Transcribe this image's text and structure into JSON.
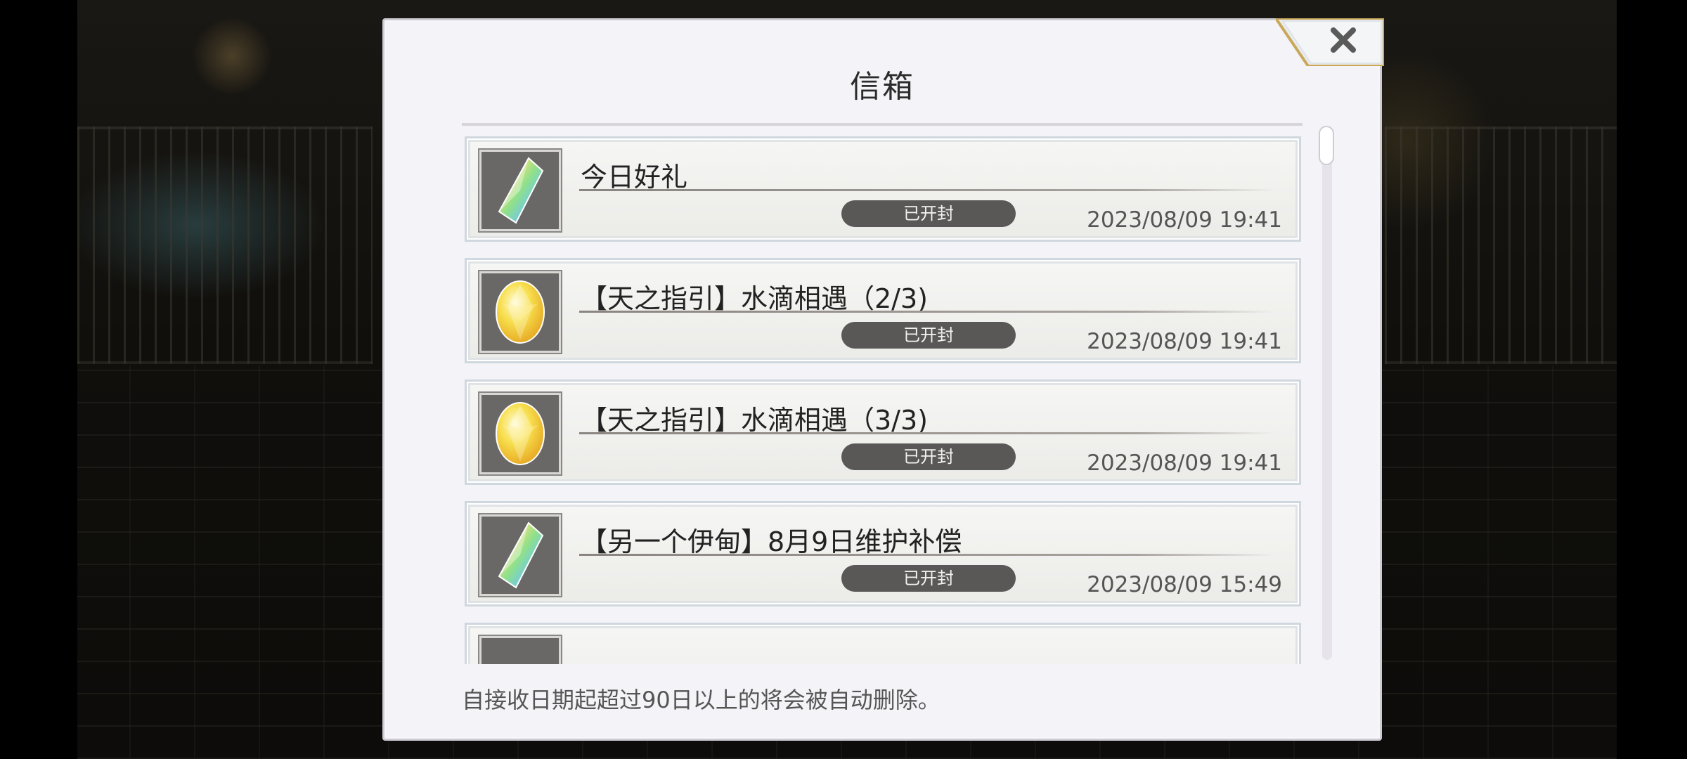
{
  "dialog": {
    "title": "信箱",
    "close_icon": "close-x-icon",
    "footer_note": "自接收日期起超过90日以上的将会被自动删除。"
  },
  "mail_items": [
    {
      "title": "今日好礼",
      "status": "已开封",
      "date": "2023/08/09 19:41",
      "icon": "rainbow-crystal-icon"
    },
    {
      "title": "【天之指引】水滴相遇（2/3)",
      "status": "已开封",
      "date": "2023/08/09 19:41",
      "icon": "golden-gem-icon"
    },
    {
      "title": "【天之指引】水滴相遇（3/3)",
      "status": "已开封",
      "date": "2023/08/09 19:41",
      "icon": "golden-gem-icon"
    },
    {
      "title": "【另一个伊甸】8月9日维护补偿",
      "status": "已开封",
      "date": "2023/08/09 15:49",
      "icon": "rainbow-crystal-icon"
    }
  ],
  "colors": {
    "dialog_bg": "#f4f3f7",
    "badge_bg": "#595857",
    "close_frame_gold": "#c9a85a"
  }
}
